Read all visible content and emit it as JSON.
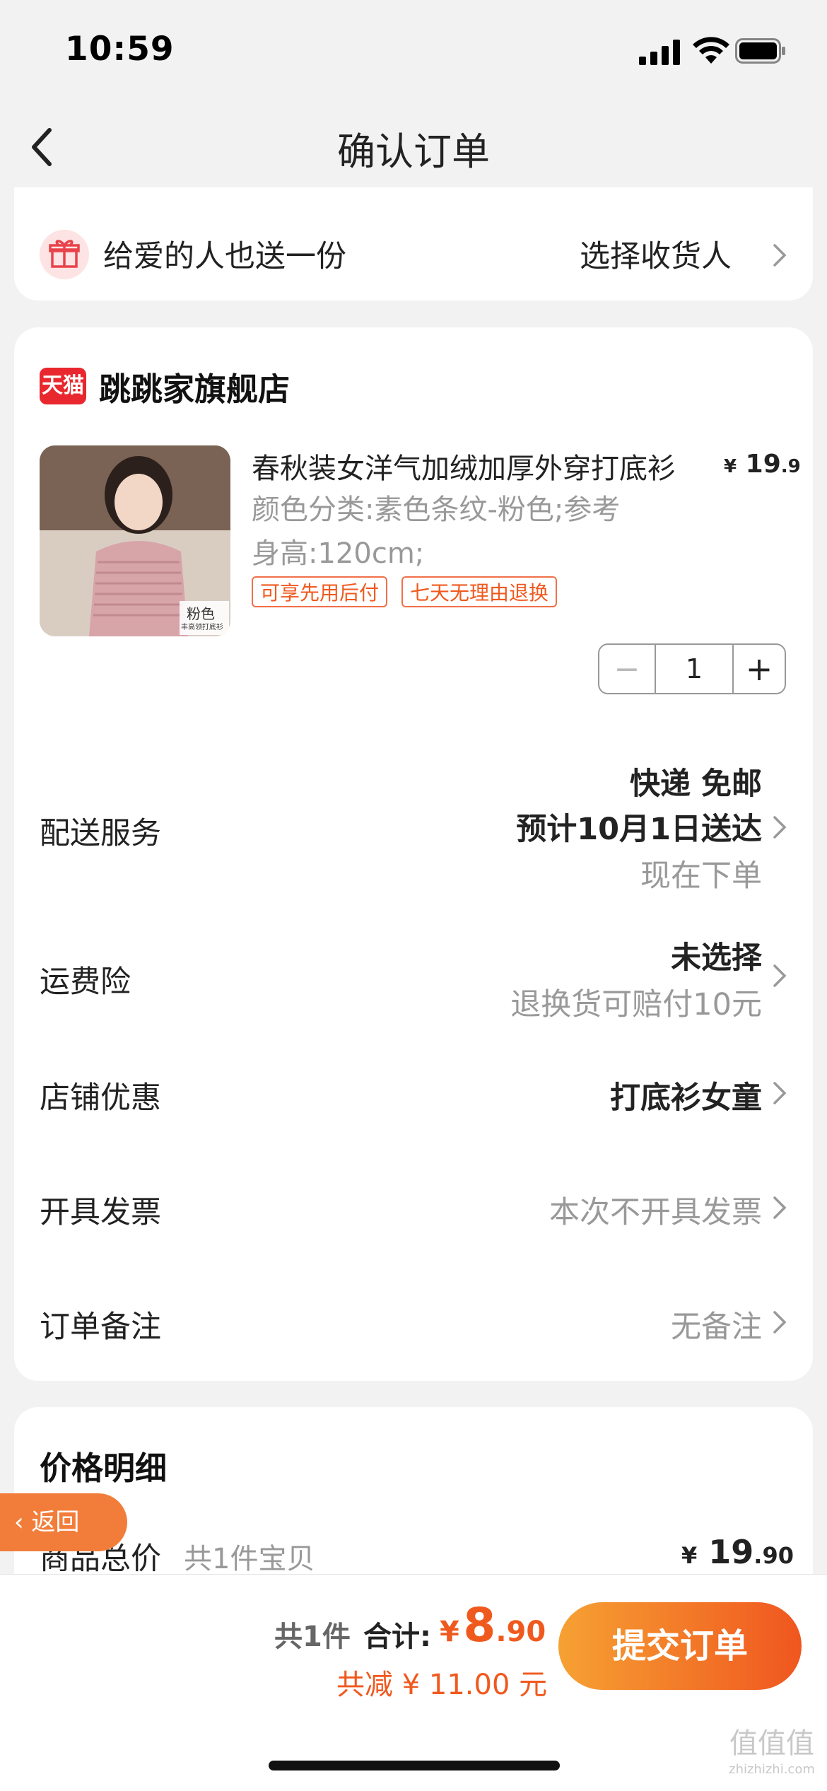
{
  "status_bar": {
    "time": "10:59"
  },
  "nav": {
    "title": "确认订单"
  },
  "gift": {
    "text": "给爱的人也送一份",
    "action": "选择收货人"
  },
  "store": {
    "badge": "天猫",
    "name": "跳跳家旗舰店"
  },
  "product": {
    "name": "春秋装女洋气加绒加厚外穿打底衫",
    "price_currency": "¥",
    "price_int": "19",
    "price_dec": ".9",
    "spec_line1": "颜色分类:素色条纹-粉色;参考",
    "spec_line2": "身高:120cm;",
    "image_label": "粉色",
    "image_sublabel": "丰高领打底衫",
    "tags": [
      "可享先用后付",
      "七天无理由退换"
    ],
    "quantity": "1",
    "minus": "−",
    "plus": "+"
  },
  "rows": {
    "delivery": {
      "label": "配送服务",
      "line1": "快递 免邮",
      "line2": "预计10月1日送达",
      "line3": "现在下单"
    },
    "insurance": {
      "label": "运费险",
      "line1": "未选择",
      "line2": "退换货可赔付10元"
    },
    "coupon": {
      "label": "店铺优惠",
      "value": "打底衫女童"
    },
    "invoice": {
      "label": "开具发票",
      "value": "本次不开具发票"
    },
    "note": {
      "label": "订单备注",
      "value": "无备注"
    }
  },
  "price_detail": {
    "title": "价格明细",
    "goods_label": "商品总价",
    "goods_sub": "共1件宝贝",
    "goods_currency": "¥",
    "goods_int": "19",
    "goods_dec": ".90"
  },
  "float_button": {
    "label": "返回"
  },
  "bottom_bar": {
    "count": "共1件",
    "total_label": "合计:",
    "total_currency": "¥",
    "total_int": "8",
    "total_dec": ".90",
    "saved": "共减 ¥ 11.00 元",
    "submit": "提交订单"
  },
  "watermark": {
    "line1": "值值值",
    "line2": "zhizhizhi.com"
  },
  "colors": {
    "accent": "#f0591e",
    "tmall": "#e8282e",
    "bg": "#f2f2f2"
  }
}
